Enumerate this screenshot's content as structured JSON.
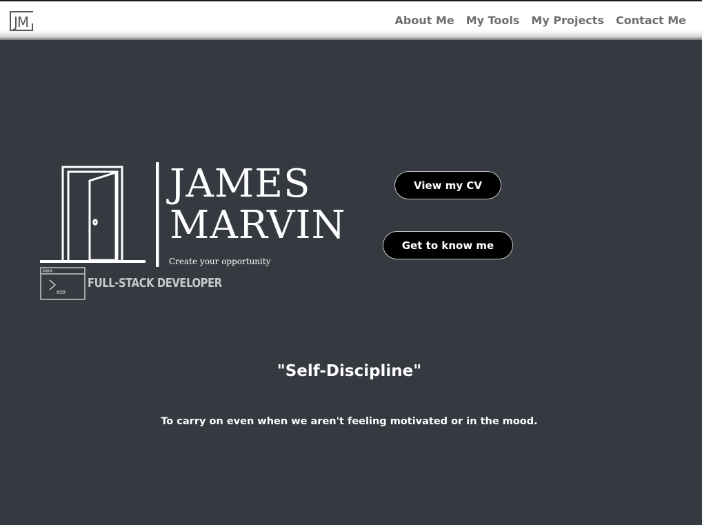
{
  "header": {
    "logo_text": "JM",
    "nav": [
      {
        "label": "About Me"
      },
      {
        "label": "My Tools"
      },
      {
        "label": "My Projects"
      },
      {
        "label": "Contact Me"
      }
    ]
  },
  "hero": {
    "first_name": "JAMES",
    "last_name": "MARVIN",
    "tagline": "Create your opportunity",
    "role": "FULL-STACK DEVELOPER",
    "buttons": {
      "cv": "View my CV",
      "know": "Get to know me"
    }
  },
  "quote": {
    "title": "\"Self-Discipline\"",
    "text": "To carry on even when we aren't feeling motivated or in the mood."
  },
  "colors": {
    "background": "#353940",
    "header": "#ffffff",
    "button": "#000000",
    "text": "#ffffff"
  }
}
